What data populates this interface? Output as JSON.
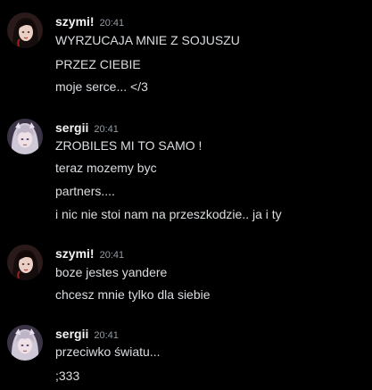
{
  "messages": [
    {
      "username": "szymi!",
      "timestamp": "20:41",
      "avatar": "dark-haired-avatar",
      "lines": [
        "WYRZUCAJA MNIE Z SOJUSZU",
        "PRZEZ CIEBIE",
        "moje serce... </3"
      ]
    },
    {
      "username": "sergii",
      "timestamp": "20:41",
      "avatar": "white-haired-avatar",
      "lines": [
        "ZROBILES MI TO SAMO !",
        "teraz mozemy byc",
        "partners....",
        "i nic nie stoi nam na przeszkodzie.. ja i ty"
      ]
    },
    {
      "username": "szymi!",
      "timestamp": "20:41",
      "avatar": "dark-haired-avatar",
      "lines": [
        "boze jestes yandere",
        "chcesz mnie tylko dla siebie"
      ]
    },
    {
      "username": "sergii",
      "timestamp": "20:41",
      "avatar": "white-haired-avatar",
      "lines": [
        "przeciwko światu...",
        ";333"
      ]
    }
  ]
}
